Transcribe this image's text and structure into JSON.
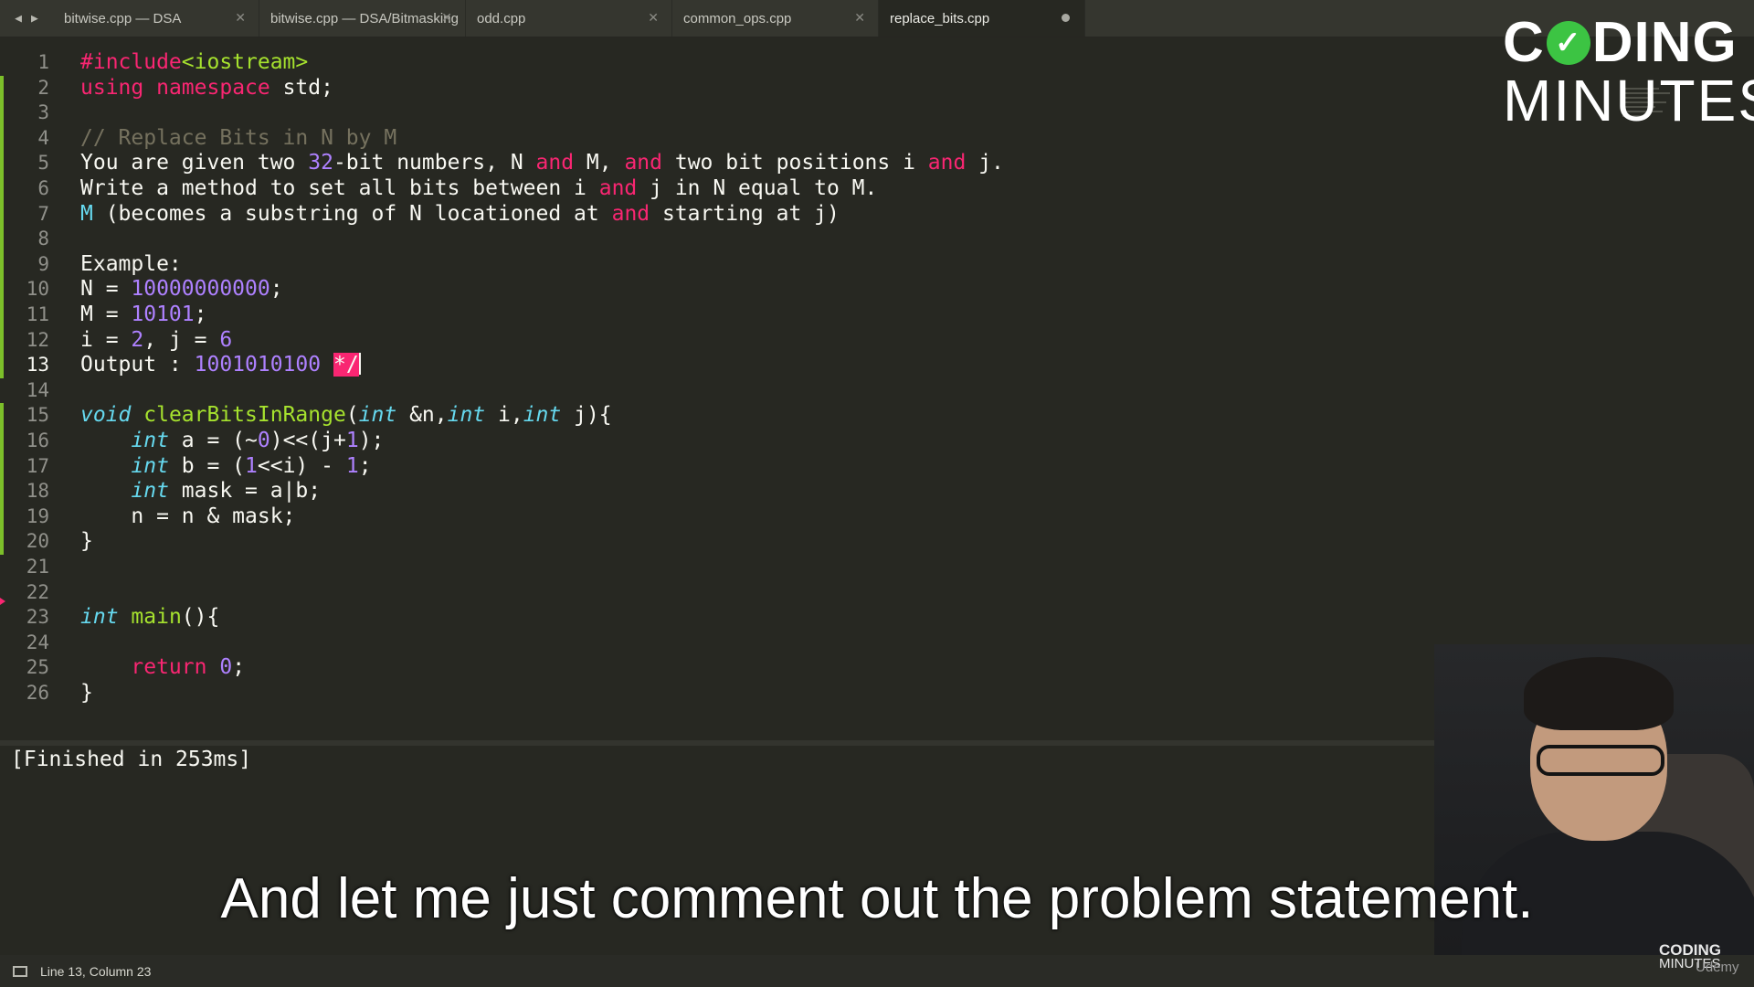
{
  "tabs": [
    {
      "label": "bitwise.cpp — DSA",
      "active": false
    },
    {
      "label": "bitwise.cpp — DSA/Bitmasking",
      "active": false
    },
    {
      "label": "odd.cpp",
      "active": false
    },
    {
      "label": "common_ops.cpp",
      "active": false
    },
    {
      "label": "replace_bits.cpp",
      "active": true
    }
  ],
  "editor": {
    "line_numbers": [
      "1",
      "2",
      "3",
      "4",
      "5",
      "6",
      "7",
      "8",
      "9",
      "10",
      "11",
      "12",
      "13",
      "14",
      "15",
      "16",
      "17",
      "18",
      "19",
      "20",
      "21",
      "22",
      "23",
      "24",
      "25",
      "26"
    ],
    "current_line": "13",
    "colors": {
      "keyword": "#f92672",
      "type": "#66d9ef",
      "function": "#a6e22e",
      "number": "#ae81ff",
      "comment": "#75715e",
      "text": "#f8f8f2",
      "background": "#272822"
    },
    "lines": [
      [
        {
          "t": "#include",
          "c": "kw"
        },
        {
          "t": "<iostream>",
          "c": "fn"
        }
      ],
      [
        {
          "t": "using",
          "c": "kw"
        },
        {
          "t": " "
        },
        {
          "t": "namespace",
          "c": "kw"
        },
        {
          "t": " std;"
        }
      ],
      [],
      [
        {
          "t": "// Replace Bits in N by M",
          "c": "cm"
        }
      ],
      [
        {
          "t": "You are given two "
        },
        {
          "t": "32",
          "c": "nm"
        },
        {
          "t": "-bit numbers, N "
        },
        {
          "t": "and",
          "c": "kw"
        },
        {
          "t": " M, "
        },
        {
          "t": "and",
          "c": "kw"
        },
        {
          "t": " two bit positions i "
        },
        {
          "t": "and",
          "c": "kw"
        },
        {
          "t": " j."
        }
      ],
      [
        {
          "t": "Write a method to set all bits between i "
        },
        {
          "t": "and",
          "c": "kw"
        },
        {
          "t": " j in N equal to M."
        }
      ],
      [
        {
          "t": "M",
          "c": "ty2"
        },
        {
          "t": " (becomes a substring of N locationed at "
        },
        {
          "t": "and",
          "c": "kw"
        },
        {
          "t": " starting at j)"
        }
      ],
      [],
      [
        {
          "t": "Example:"
        }
      ],
      [
        {
          "t": "N = "
        },
        {
          "t": "10000000000",
          "c": "nm"
        },
        {
          "t": ";"
        }
      ],
      [
        {
          "t": "M = "
        },
        {
          "t": "10101",
          "c": "nm"
        },
        {
          "t": ";"
        }
      ],
      [
        {
          "t": "i = "
        },
        {
          "t": "2",
          "c": "nm"
        },
        {
          "t": ", j = "
        },
        {
          "t": "6",
          "c": "nm"
        }
      ],
      [
        {
          "t": "Output : "
        },
        {
          "t": "1001010100",
          "c": "nm"
        },
        {
          "t": " "
        },
        {
          "t": "*/",
          "c": "sel"
        },
        {
          "t": "",
          "c": "caret"
        }
      ],
      [],
      [
        {
          "t": "void",
          "c": "ty"
        },
        {
          "t": " "
        },
        {
          "t": "clearBitsInRange",
          "c": "fn"
        },
        {
          "t": "("
        },
        {
          "t": "int",
          "c": "ty"
        },
        {
          "t": " &n,"
        },
        {
          "t": "int",
          "c": "ty"
        },
        {
          "t": " i,"
        },
        {
          "t": "int",
          "c": "ty"
        },
        {
          "t": " j){"
        }
      ],
      [
        {
          "t": "    "
        },
        {
          "t": "int",
          "c": "ty"
        },
        {
          "t": " a = (~"
        },
        {
          "t": "0",
          "c": "nm"
        },
        {
          "t": ")<<(j+"
        },
        {
          "t": "1",
          "c": "nm"
        },
        {
          "t": ");"
        }
      ],
      [
        {
          "t": "    "
        },
        {
          "t": "int",
          "c": "ty"
        },
        {
          "t": " b = ("
        },
        {
          "t": "1",
          "c": "nm"
        },
        {
          "t": "<<i) - "
        },
        {
          "t": "1",
          "c": "nm"
        },
        {
          "t": ";"
        }
      ],
      [
        {
          "t": "    "
        },
        {
          "t": "int",
          "c": "ty"
        },
        {
          "t": " mask = a|b;"
        }
      ],
      [
        {
          "t": "    n = n & mask;"
        }
      ],
      [
        {
          "t": "}"
        }
      ],
      [],
      [],
      [
        {
          "t": "int",
          "c": "ty"
        },
        {
          "t": " "
        },
        {
          "t": "main",
          "c": "fn"
        },
        {
          "t": "(){"
        }
      ],
      [],
      [
        {
          "t": "    "
        },
        {
          "t": "return",
          "c": "kw"
        },
        {
          "t": " "
        },
        {
          "t": "0",
          "c": "nm"
        },
        {
          "t": ";"
        }
      ],
      [
        {
          "t": "}"
        }
      ]
    ]
  },
  "output_panel": {
    "text": "[Finished in 253ms]"
  },
  "logo": {
    "line1_a": "C",
    "line1_b": "DING",
    "line2": "MINUTES"
  },
  "subtitle": "And let me just comment out the problem statement.",
  "statusbar": {
    "position": "Line 13, Column 23"
  },
  "watermark": {
    "line1": "CODING",
    "line2": "MINUTES",
    "line3": "Udemy"
  }
}
